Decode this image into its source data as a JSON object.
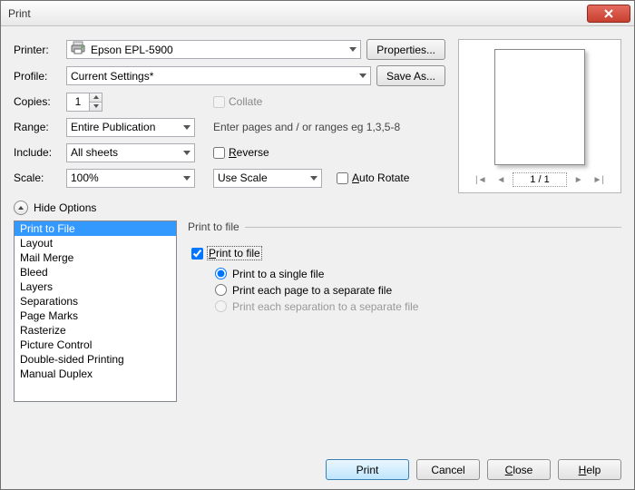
{
  "window": {
    "title": "Print"
  },
  "labels": {
    "printer": "Printer:",
    "profile": "Profile:",
    "copies": "Copies:",
    "range": "Range:",
    "include": "Include:",
    "scale": "Scale:",
    "collate": "Collate",
    "range_hint": "Enter pages and / or ranges eg 1,3,5-8",
    "reverse": "Reverse",
    "use_scale": "Use Scale",
    "auto_rotate": "Auto Rotate",
    "hide_options": "Hide Options"
  },
  "form": {
    "printer": "Epson EPL-5900",
    "profile": "Current Settings*",
    "copies": "1",
    "range": "Entire Publication",
    "include": "All sheets",
    "scale": "100%"
  },
  "buttons": {
    "properties": "Properties...",
    "save_as": "Save As...",
    "print": "Print",
    "cancel": "Cancel",
    "close": "Close",
    "help": "Help"
  },
  "preview": {
    "page_indicator": "1 / 1"
  },
  "options_list": [
    "Print to File",
    "Layout",
    "Mail Merge",
    "Bleed",
    "Layers",
    "Separations",
    "Page Marks",
    "Rasterize",
    "Picture Control",
    "Double-sided Printing",
    "Manual Duplex"
  ],
  "ptf": {
    "legend": "Print to file",
    "enable": "Print to file",
    "single": "Print to a single file",
    "each_page": "Print each page to a separate file",
    "each_sep": "Print each separation to a separate file"
  }
}
